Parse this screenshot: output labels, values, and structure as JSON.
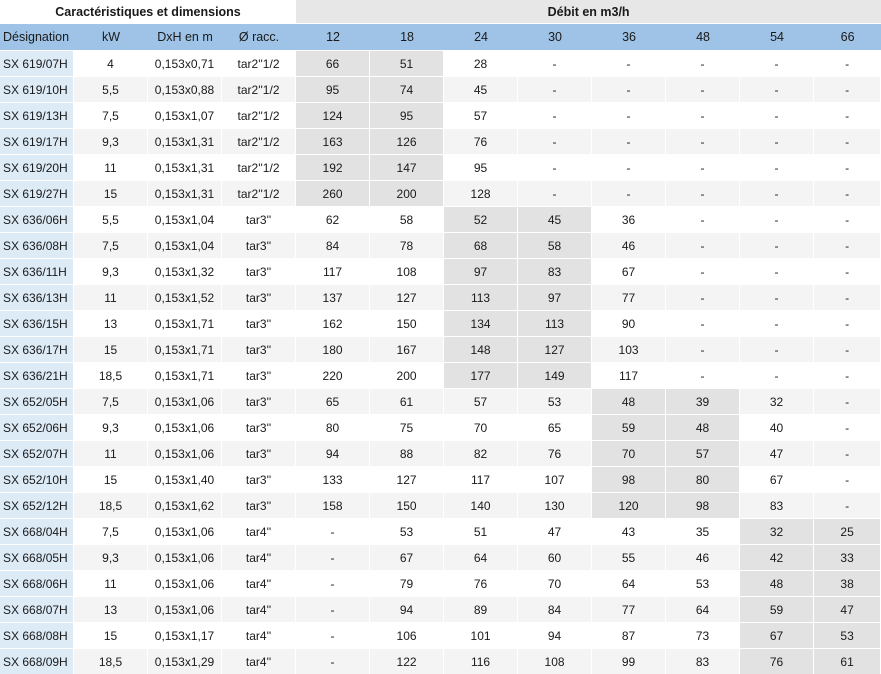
{
  "sections": {
    "left": "Caractéristiques et dimensions",
    "right": "Débit en m3/h"
  },
  "columns": [
    "Désignation",
    "kW",
    "DxH en m",
    "Ø racc.",
    "12",
    "18",
    "24",
    "30",
    "36",
    "48",
    "54",
    "66"
  ],
  "rows": [
    [
      "SX 619/07H",
      "4",
      "0,153x0,71",
      "tar2''1/2",
      "66",
      "51",
      "28",
      "-",
      "-",
      "-",
      "-",
      "-"
    ],
    [
      "SX 619/10H",
      "5,5",
      "0,153x0,88",
      "tar2''1/2",
      "95",
      "74",
      "45",
      "-",
      "-",
      "-",
      "-",
      "-"
    ],
    [
      "SX 619/13H",
      "7,5",
      "0,153x1,07",
      "tar2''1/2",
      "124",
      "95",
      "57",
      "-",
      "-",
      "-",
      "-",
      "-"
    ],
    [
      "SX 619/17H",
      "9,3",
      "0,153x1,31",
      "tar2''1/2",
      "163",
      "126",
      "76",
      "-",
      "-",
      "-",
      "-",
      "-"
    ],
    [
      "SX 619/20H",
      "11",
      "0,153x1,31",
      "tar2''1/2",
      "192",
      "147",
      "95",
      "-",
      "-",
      "-",
      "-",
      "-"
    ],
    [
      "SX 619/27H",
      "15",
      "0,153x1,31",
      "tar2''1/2",
      "260",
      "200",
      "128",
      "-",
      "-",
      "-",
      "-",
      "-"
    ],
    [
      "SX 636/06H",
      "5,5",
      "0,153x1,04",
      "tar3''",
      "62",
      "58",
      "52",
      "45",
      "36",
      "-",
      "-",
      "-"
    ],
    [
      "SX 636/08H",
      "7,5",
      "0,153x1,04",
      "tar3''",
      "84",
      "78",
      "68",
      "58",
      "46",
      "-",
      "-",
      "-"
    ],
    [
      "SX 636/11H",
      "9,3",
      "0,153x1,32",
      "tar3''",
      "117",
      "108",
      "97",
      "83",
      "67",
      "-",
      "-",
      "-"
    ],
    [
      "SX 636/13H",
      "11",
      "0,153x1,52",
      "tar3''",
      "137",
      "127",
      "113",
      "97",
      "77",
      "-",
      "-",
      "-"
    ],
    [
      "SX 636/15H",
      "13",
      "0,153x1,71",
      "tar3''",
      "162",
      "150",
      "134",
      "113",
      "90",
      "-",
      "-",
      "-"
    ],
    [
      "SX 636/17H",
      "15",
      "0,153x1,71",
      "tar3''",
      "180",
      "167",
      "148",
      "127",
      "103",
      "-",
      "-",
      "-"
    ],
    [
      "SX 636/21H",
      "18,5",
      "0,153x1,71",
      "tar3''",
      "220",
      "200",
      "177",
      "149",
      "117",
      "-",
      "-",
      "-"
    ],
    [
      "SX 652/05H",
      "7,5",
      "0,153x1,06",
      "tar3''",
      "65",
      "61",
      "57",
      "53",
      "48",
      "39",
      "32",
      "-"
    ],
    [
      "SX 652/06H",
      "9,3",
      "0,153x1,06",
      "tar3''",
      "80",
      "75",
      "70",
      "65",
      "59",
      "48",
      "40",
      "-"
    ],
    [
      "SX 652/07H",
      "11",
      "0,153x1,06",
      "tar3''",
      "94",
      "88",
      "82",
      "76",
      "70",
      "57",
      "47",
      "-"
    ],
    [
      "SX 652/10H",
      "15",
      "0,153x1,40",
      "tar3''",
      "133",
      "127",
      "117",
      "107",
      "98",
      "80",
      "67",
      "-"
    ],
    [
      "SX 652/12H",
      "18,5",
      "0,153x1,62",
      "tar3''",
      "158",
      "150",
      "140",
      "130",
      "120",
      "98",
      "83",
      "-"
    ],
    [
      "SX 668/04H",
      "7,5",
      "0,153x1,06",
      "tar4''",
      "-",
      "53",
      "51",
      "47",
      "43",
      "35",
      "32",
      "25"
    ],
    [
      "SX 668/05H",
      "9,3",
      "0,153x1,06",
      "tar4''",
      "-",
      "67",
      "64",
      "60",
      "55",
      "46",
      "42",
      "33"
    ],
    [
      "SX 668/06H",
      "11",
      "0,153x1,06",
      "tar4''",
      "-",
      "79",
      "76",
      "70",
      "64",
      "53",
      "48",
      "38"
    ],
    [
      "SX 668/07H",
      "13",
      "0,153x1,06",
      "tar4''",
      "-",
      "94",
      "89",
      "84",
      "77",
      "64",
      "59",
      "47"
    ],
    [
      "SX 668/08H",
      "15",
      "0,153x1,17",
      "tar4''",
      "-",
      "106",
      "101",
      "94",
      "87",
      "73",
      "67",
      "53"
    ],
    [
      "SX 668/09H",
      "18,5",
      "0,153x1,29",
      "tar4''",
      "-",
      "122",
      "116",
      "108",
      "99",
      "83",
      "76",
      "61"
    ]
  ],
  "highlight_groups": [
    {
      "row_start": 0,
      "row_end": 5,
      "col_start": 4,
      "col_end": 5
    },
    {
      "row_start": 6,
      "row_end": 12,
      "col_start": 6,
      "col_end": 7
    },
    {
      "row_start": 13,
      "row_end": 17,
      "col_start": 8,
      "col_end": 9
    },
    {
      "row_start": 18,
      "row_end": 23,
      "col_start": 10,
      "col_end": 11
    }
  ],
  "colors": {
    "header_blue": "#9ec3e6",
    "designation_blue": "#ddebf7",
    "highlight_gray": "#e2e2e2",
    "stripe_gray": "#f4f4f4"
  }
}
